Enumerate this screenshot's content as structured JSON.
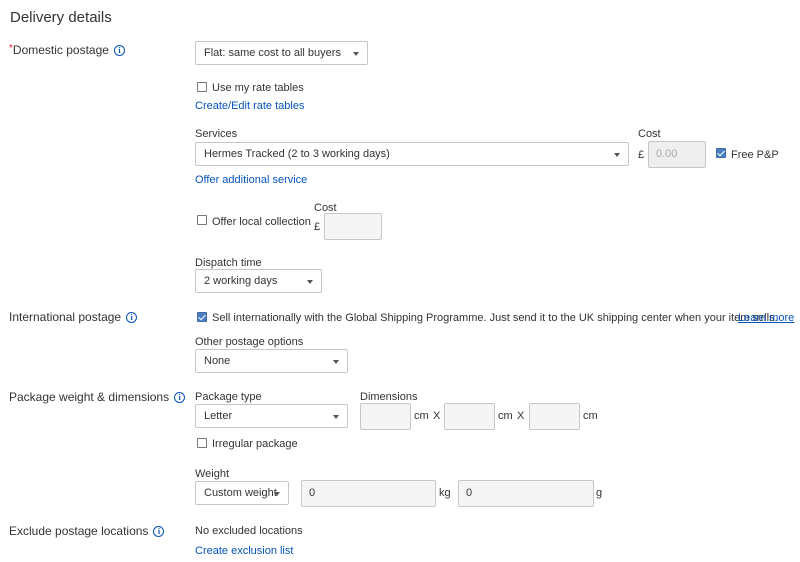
{
  "section_title": "Delivery details",
  "domestic": {
    "required_marker": "*",
    "label": "Domestic postage",
    "postage_type": "Flat: same cost to all buyers",
    "use_rate_tables_label": "Use my rate tables",
    "use_rate_tables_checked": false,
    "rate_tables_link": "Create/Edit rate tables",
    "services_label": "Services",
    "service_selected": "Hermes Tracked (2 to 3 working days)",
    "cost_label": "Cost",
    "currency": "£",
    "cost_value": "0.00",
    "free_pp_label": "Free P&P",
    "free_pp_checked": true,
    "offer_additional_link": "Offer additional service",
    "local_collection_label": "Offer local collection",
    "local_collection_checked": false,
    "local_cost_label": "Cost",
    "local_currency": "£",
    "local_cost_value": "",
    "dispatch_label": "Dispatch time",
    "dispatch_selected": "2 working days"
  },
  "international": {
    "label": "International postage",
    "gsp_checked": true,
    "gsp_text": "Sell internationally with the Global Shipping Programme. Just send it to the UK shipping center when your item sells.",
    "learn_more": "Learn more",
    "other_options_label": "Other postage options",
    "other_options_selected": "None"
  },
  "package": {
    "label": "Package weight & dimensions",
    "type_label": "Package type",
    "type_selected": "Letter",
    "dimensions_label": "Dimensions",
    "dim_length": "",
    "dim_width": "",
    "dim_height": "",
    "unit_cm": "cm",
    "times": "X",
    "irregular_label": "Irregular package",
    "irregular_checked": false,
    "weight_label": "Weight",
    "weight_type": "Custom weight",
    "weight_kg": "0",
    "unit_kg": "kg",
    "weight_g": "0",
    "unit_g": "g"
  },
  "exclude": {
    "label": "Exclude postage locations",
    "status": "No excluded locations",
    "create_link": "Create exclusion list"
  },
  "icons": {
    "info": "i"
  },
  "colors": {
    "link": "#0654ba",
    "required": "#dd1e31",
    "checkbox_checked": "#4b7fc4"
  }
}
